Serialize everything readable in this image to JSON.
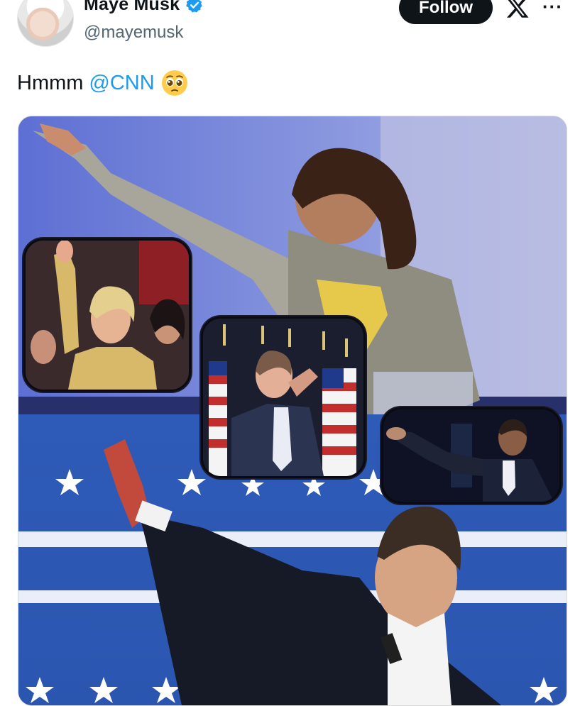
{
  "profile": {
    "display_name": "Maye Musk",
    "handle": "@mayemusk",
    "verified": true
  },
  "header": {
    "follow_label": "Follow",
    "logo_text": "X",
    "more_label": "···"
  },
  "tweet": {
    "text": "Hmmm",
    "mention": "@CNN",
    "emoji": "pleading-face-emoji"
  },
  "colors": {
    "mention_blue": "#1d9bf0",
    "verified_blue": "#1d9bf0",
    "follow_bg": "#0f1419",
    "handle_grey": "#536471"
  },
  "media": {
    "type": "photo-collage",
    "panels": [
      "background-photo",
      "inset-photo-left",
      "inset-photo-center",
      "inset-photo-right",
      "foreground-photo"
    ]
  }
}
